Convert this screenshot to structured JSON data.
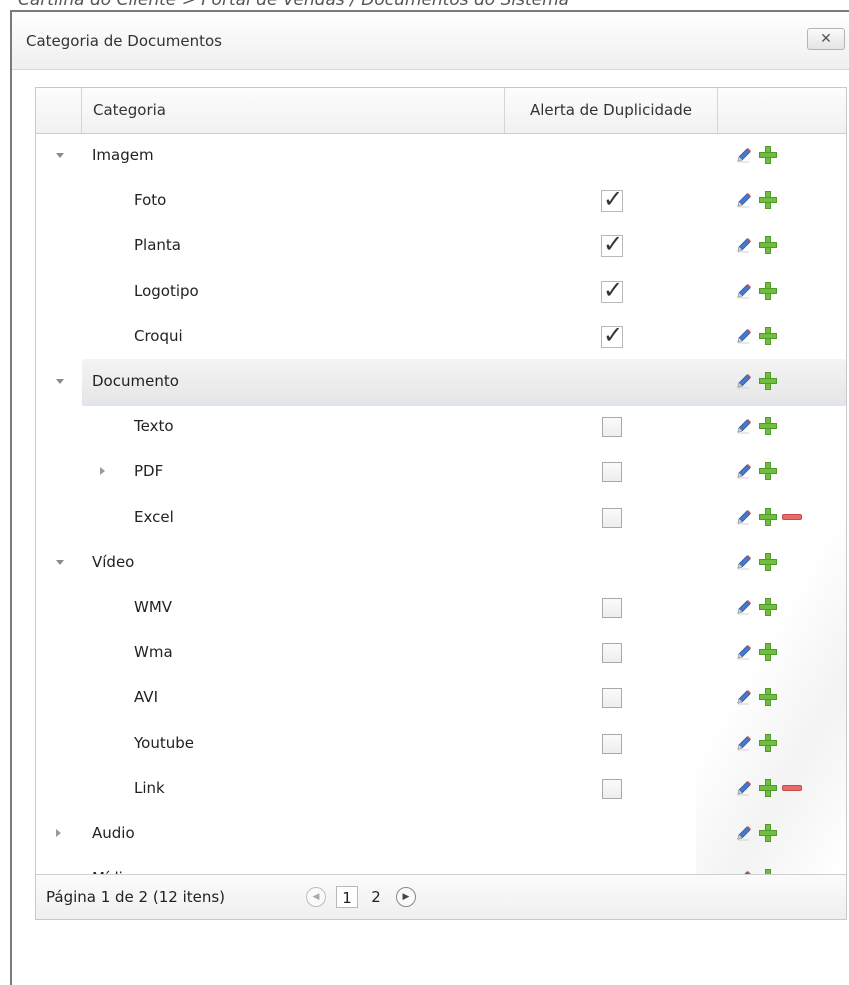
{
  "breadcrumb": "Cartilha do Cliente > Portal de Vendas / Documentos do Sistema",
  "dialog": {
    "title": "Categoria de Documentos",
    "close_label": "✕"
  },
  "grid": {
    "columns": {
      "category": "Categoria",
      "duplicate_alert": "Alerta de Duplicidade"
    },
    "rows": [
      {
        "label": "Imagem",
        "level": 0,
        "expander": "expanded",
        "checkbox": null,
        "remove": false
      },
      {
        "label": "Foto",
        "level": 1,
        "expander": null,
        "checkbox": true,
        "remove": false
      },
      {
        "label": "Planta",
        "level": 1,
        "expander": null,
        "checkbox": true,
        "remove": false
      },
      {
        "label": "Logotipo",
        "level": 1,
        "expander": null,
        "checkbox": true,
        "remove": false
      },
      {
        "label": "Croqui",
        "level": 1,
        "expander": null,
        "checkbox": true,
        "remove": false
      },
      {
        "label": "Documento",
        "level": 0,
        "expander": "expanded",
        "checkbox": null,
        "remove": false,
        "selected": true
      },
      {
        "label": "Texto",
        "level": 1,
        "expander": null,
        "checkbox": false,
        "remove": false
      },
      {
        "label": "PDF",
        "level": 1,
        "expander": "collapsed",
        "checkbox": false,
        "remove": false
      },
      {
        "label": "Excel",
        "level": 1,
        "expander": null,
        "checkbox": false,
        "remove": true
      },
      {
        "label": "Vídeo",
        "level": 0,
        "expander": "expanded",
        "checkbox": null,
        "remove": false
      },
      {
        "label": "WMV",
        "level": 1,
        "expander": null,
        "checkbox": false,
        "remove": false
      },
      {
        "label": "Wma",
        "level": 1,
        "expander": null,
        "checkbox": false,
        "remove": false
      },
      {
        "label": "AVI",
        "level": 1,
        "expander": null,
        "checkbox": false,
        "remove": false
      },
      {
        "label": "Youtube",
        "level": 1,
        "expander": null,
        "checkbox": false,
        "remove": false
      },
      {
        "label": "Link",
        "level": 1,
        "expander": null,
        "checkbox": false,
        "remove": true
      },
      {
        "label": "Audio",
        "level": 0,
        "expander": "collapsed",
        "checkbox": null,
        "remove": false
      },
      {
        "label": "Mídia",
        "level": 0,
        "expander": "expanded",
        "checkbox": null,
        "remove": false
      }
    ]
  },
  "pager": {
    "summary": "Página 1 de 2 (12 itens)",
    "pages": [
      "1",
      "2"
    ],
    "current_page": "1"
  },
  "icons": {
    "add": "plus-icon",
    "edit": "pencil-icon",
    "remove": "minus-icon",
    "prev": "circle-arrow-left-icon",
    "next": "circle-arrow-right-icon",
    "close": "close-icon"
  },
  "colors": {
    "add_green": "#6fbe3f",
    "remove_red": "#e86a6a",
    "selected_row_underline": "#dbe5f6"
  }
}
